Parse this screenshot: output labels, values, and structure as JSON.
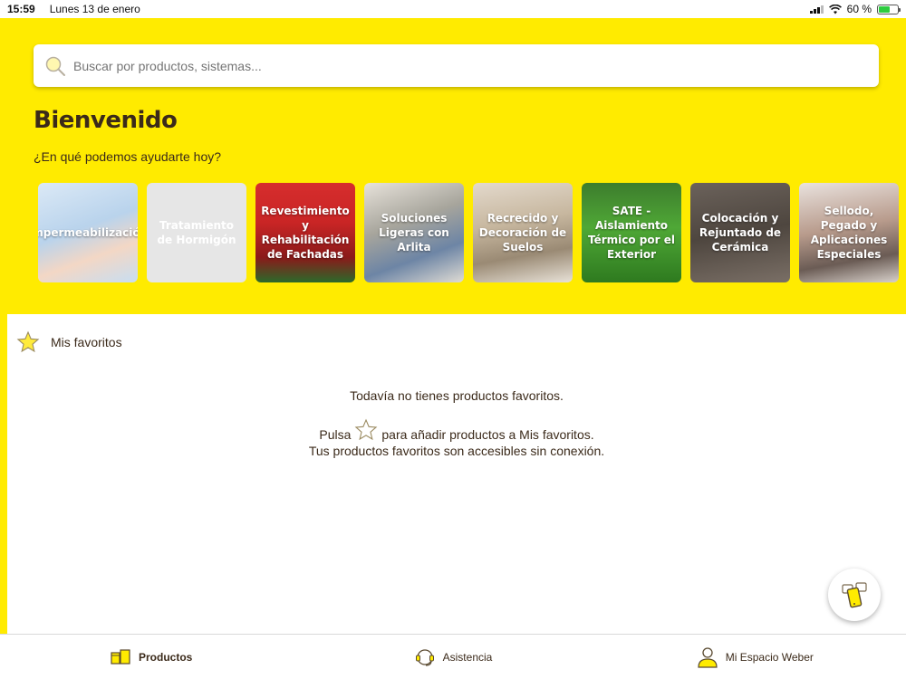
{
  "status_bar": {
    "time": "15:59",
    "date": "Lunes 13 de enero",
    "battery": "60 %",
    "battery_level": 0.6
  },
  "search": {
    "placeholder": "Buscar por productos, sistemas..."
  },
  "header": {
    "title": "Bienvenido",
    "subtitle": "¿En qué podemos ayudarte hoy?"
  },
  "categories": [
    {
      "label": "Impermeabilización"
    },
    {
      "label": "Tratamiento de Hormigón"
    },
    {
      "label": "Revestimiento y Rehabilitación de Fachadas"
    },
    {
      "label": "Soluciones Ligeras con Arlita"
    },
    {
      "label": "Recrecido y Decoración de Suelos"
    },
    {
      "label": "SATE - Aislamiento Térmico por el Exterior"
    },
    {
      "label": "Colocación y Rejuntado de Cerámica"
    },
    {
      "label": "Sellodo, Pegado y Aplicaciones Especiales"
    }
  ],
  "favorites": {
    "title": "Mis favoritos",
    "empty_line1": "Todavía no tienes productos favoritos.",
    "empty_line2_before": "Pulsa",
    "empty_line2_after": "para añadir productos a Mis favoritos.",
    "empty_line3": "Tus productos favoritos son accesibles sin conexión."
  },
  "tabs": [
    {
      "label": "Productos",
      "icon": "products-icon",
      "active": true
    },
    {
      "label": "Asistencia",
      "icon": "headset-icon",
      "active": false
    },
    {
      "label": "Mi Espacio Weber",
      "icon": "user-icon",
      "active": false
    }
  ],
  "colors": {
    "brand_yellow": "#ffeb00",
    "text_brown": "#3b2a1a"
  }
}
